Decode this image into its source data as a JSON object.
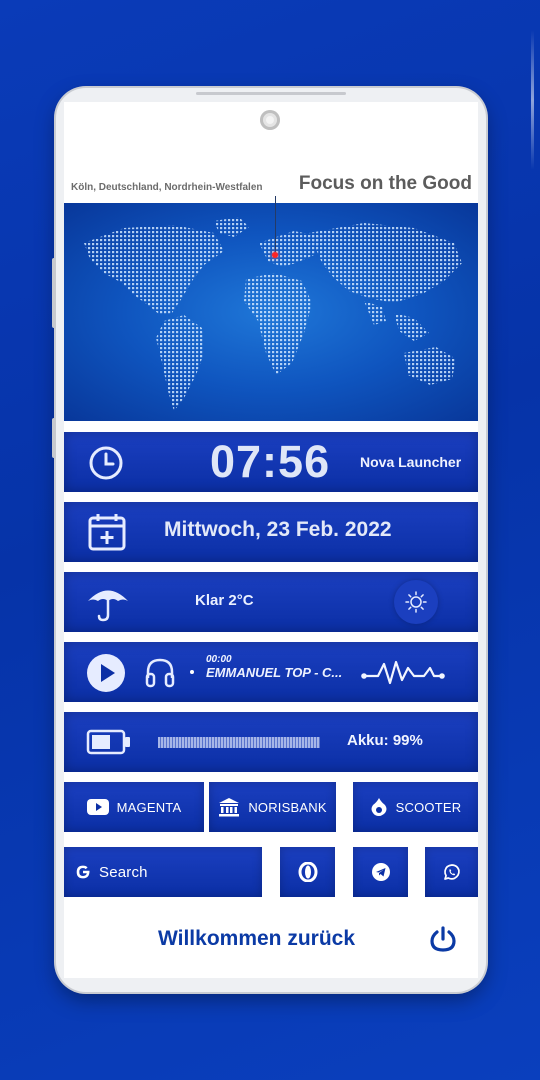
{
  "header": {
    "location": "Köln, Deutschland, Nordrhein-Westfalen",
    "tagline": "Focus on the Good"
  },
  "clock": {
    "time": "07:56",
    "launcher": "Nova Launcher",
    "icon": "clock-icon"
  },
  "date": {
    "text": "Mittwoch, 23 Feb. 2022",
    "icon": "calendar-add-icon"
  },
  "weather": {
    "text": "Klar 2°C",
    "icon": "umbrella-icon",
    "condition_icon": "sun-icon"
  },
  "music": {
    "elapsed": "00:00",
    "title": "EMMANUEL TOP - C...",
    "icons": [
      "play-icon",
      "headphones-icon",
      "waveform-icon"
    ]
  },
  "battery": {
    "label": "Akku: 99%",
    "level": 0.99,
    "icon": "battery-icon"
  },
  "shortcuts": [
    {
      "label": "MAGENTA",
      "icon": "youtube-icon"
    },
    {
      "label": "NORISBANK",
      "icon": "bank-icon"
    },
    {
      "label": "SCOOTER",
      "icon": "drupal-icon"
    }
  ],
  "search": {
    "label": "Search",
    "icon": "google-g-icon"
  },
  "apps": [
    "opera-icon",
    "telegram-icon",
    "whatsapp-icon"
  ],
  "footer": {
    "welcome": "Willkommen zurück",
    "icon": "power-icon"
  },
  "colors": {
    "background": "#0633a8",
    "widget": "#0b2fa5",
    "accent": "#0b3aa5",
    "pin": "#ff2525"
  }
}
